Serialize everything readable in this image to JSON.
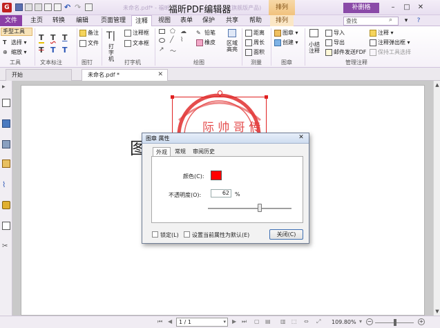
{
  "titlebar": {
    "doc_title_faded": "未命名.pdf* - 福昕",
    "app_title": "福昕PDF编辑器",
    "suffix_faded": "(旗舰版产品)",
    "context_tab": "排列",
    "register": "补删格"
  },
  "menu": {
    "tabs": [
      "文件",
      "主页",
      "转换",
      "编辑",
      "页面管理",
      "注释",
      "视图",
      "表单",
      "保护",
      "共享",
      "帮助",
      "排列"
    ],
    "active_tab": "注释",
    "search_placeholder": "查找"
  },
  "ribbon": {
    "tools": {
      "hand": "手型工具",
      "select": "选择",
      "zoom": "缩放",
      "label": "工具"
    },
    "text_markup": {
      "label": "文本标注"
    },
    "pin": {
      "note": "备注",
      "file": "文件",
      "label": "图钉"
    },
    "typewriter": {
      "typewriter": "打字机",
      "callout": "注释框",
      "textbox": "文本框",
      "label": "打字机"
    },
    "drawing": {
      "pencil": "铅笔",
      "eraser": "橡皮",
      "area_highlight": "区域高亮",
      "label": "绘图"
    },
    "measure": {
      "distance": "距离",
      "perimeter": "周长",
      "area": "面积",
      "label": "测量"
    },
    "stamp": {
      "stamp": "图章",
      "create": "创建",
      "label": "图章"
    },
    "manage": {
      "summary": "小结注释",
      "import": "导入",
      "export": "导出",
      "email": "邮件发送FDF",
      "comment": "注释",
      "popup": "注释弹出框",
      "keep_tool": "保持工具选择",
      "label": "管理注释"
    }
  },
  "doc_tabs": [
    {
      "label": "开始"
    },
    {
      "label": "未命名.pdf *"
    }
  ],
  "page": {
    "glyph": "图"
  },
  "dialog": {
    "title": "图章 属性",
    "tabs": [
      "外观",
      "常规",
      "审阅历史"
    ],
    "color_label": "颜色(C):",
    "color_value": "#ff0000",
    "opacity_label": "不透明度(O):",
    "opacity_value": "62",
    "opacity_unit": "%",
    "opacity_fraction": 0.62,
    "lock_label": "锁定(L)",
    "default_label": "设置当前属性为默认(E)",
    "close_button": "关闭(C)"
  },
  "statusbar": {
    "page_display": "1 / 1",
    "zoom": "109.80%"
  }
}
